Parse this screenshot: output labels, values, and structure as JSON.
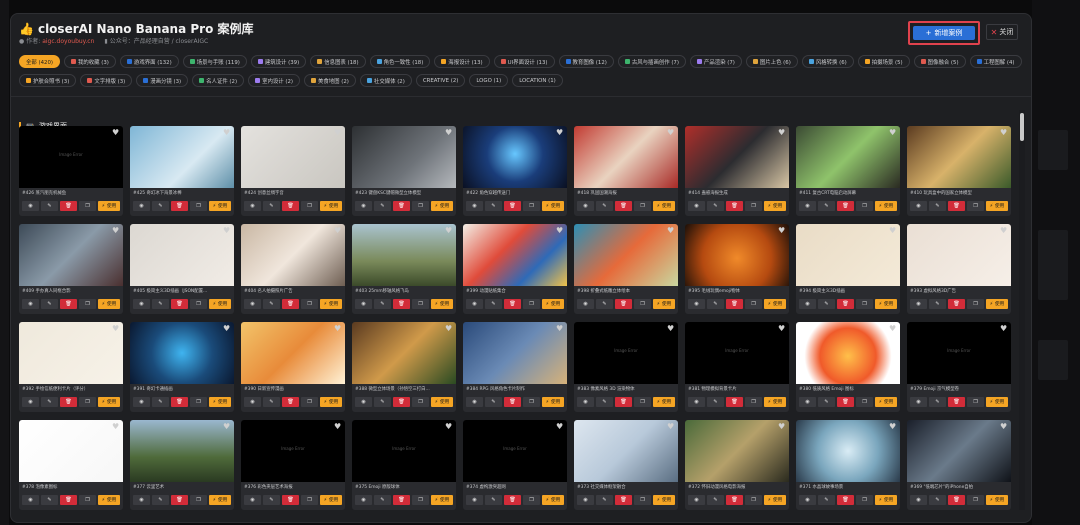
{
  "header": {
    "title": "closerAI Nano Banana Pro 案例库",
    "author_label": "作者:",
    "author_link": "aigc.doyoubuy.cn",
    "account_label": "公众号：产品经理自营 / closerAIGC",
    "new_button": "新增案例",
    "close_button": "关闭"
  },
  "tags_row1": [
    {
      "label": "全部 (420)",
      "active": true
    },
    {
      "label": "我的收藏 (3)"
    },
    {
      "label": "游戏界面 (132)"
    },
    {
      "label": "场景与手账 (119)"
    },
    {
      "label": "建筑设计 (39)"
    },
    {
      "label": "信息图表 (18)"
    },
    {
      "label": "角色一致性 (18)"
    },
    {
      "label": "海报设计 (13)"
    },
    {
      "label": "UI界面设计 (13)"
    },
    {
      "label": "教育图像 (12)"
    },
    {
      "label": "古风与插画创作 (7)"
    },
    {
      "label": "产品渲染 (7)"
    },
    {
      "label": "图片上色 (6)"
    },
    {
      "label": "风格转换 (6)"
    },
    {
      "label": "拍摄场景 (5)"
    },
    {
      "label": "图像融合 (5)"
    },
    {
      "label": "工程图解 (4)"
    }
  ],
  "tags_row2": [
    {
      "label": "护肤合照书 (3)"
    },
    {
      "label": "文字排版 (3)"
    },
    {
      "label": "漫画分镜 (3)"
    },
    {
      "label": "名人证件 (2)"
    },
    {
      "label": "室内设计 (2)"
    },
    {
      "label": "美食地图 (2)"
    },
    {
      "label": "社交媒体 (2)"
    },
    {
      "label": "CREATIVE (2)"
    },
    {
      "label": "LOGO (1)"
    },
    {
      "label": "LOCATION (1)"
    }
  ],
  "section": {
    "title": "游戏界面"
  },
  "card_labels": {
    "use": "使用",
    "image_error": "Image Error"
  },
  "cards": [
    {
      "caption": "#426 蒸汽朋克机械鱼",
      "error": true
    },
    {
      "caption": "#425 奇幻冰下海景冰棒"
    },
    {
      "caption": "#424 创意丝绸字音"
    },
    {
      "caption": "#423 键盘KSC键帽微型立体模型"
    },
    {
      "caption": "#422 角色穿越传送门"
    },
    {
      "caption": "#418 巩固国潮海报"
    },
    {
      "caption": "#414 蛊惑海报生成"
    },
    {
      "caption": "#411 复古CRT电脑启动屏幕"
    },
    {
      "caption": "#410 玩具盒中的国家立体模型"
    },
    {
      "caption": "#409 手办真人同框合影"
    },
    {
      "caption": "#405 极简主义3D插画（JSON配置..."
    },
    {
      "caption": "#404 名人拍摄照片广告"
    },
    {
      "caption": "#403 25mm移轴风格飞岛"
    },
    {
      "caption": "#399 动漫贴纸集合"
    },
    {
      "caption": "#398 折叠式纸雕立体绘本"
    },
    {
      "caption": "#395 毛绒玩偶emoji物体"
    },
    {
      "caption": "#394 极简主义3D插画"
    },
    {
      "caption": "#393 虚拟风格3D广告"
    },
    {
      "caption": "#392 手绘信纸便利卡片（评分）"
    },
    {
      "caption": "#391 奇幻卡通插画"
    },
    {
      "caption": "#390 日新宣传漫画"
    },
    {
      "caption": "#388 微型立体场景（孙悟空三打白..."
    },
    {
      "caption": "#384 RPG 风格角色卡片制作"
    },
    {
      "caption": "#383 像素风格 3D 渲染物体",
      "error": true
    },
    {
      "caption": "#381 物理模拟背景卡片",
      "error": true
    },
    {
      "caption": "#380 低质风格 Emoji 图标"
    },
    {
      "caption": "#379 Emoji 京气模型卷",
      "error": true
    },
    {
      "caption": "#378 泡像素图标"
    },
    {
      "caption": "#377 云里艺术"
    },
    {
      "caption": "#376 彩色夹层艺术海报",
      "error": true
    },
    {
      "caption": "#375 Emoji 原版球体",
      "error": true
    },
    {
      "caption": "#374 虚构激突超网",
      "error": true
    },
    {
      "caption": "#373 社交媒体框架融合"
    },
    {
      "caption": "#372 怀旧动漫风格电影海报"
    },
    {
      "caption": "#371 水晶球故事场景"
    },
    {
      "caption": "#369 \"低端芯片\"的iPhone自拍"
    }
  ],
  "colors": {
    "accent": "#f5a524",
    "danger": "#d22c39",
    "primary": "#2a6fd6"
  }
}
